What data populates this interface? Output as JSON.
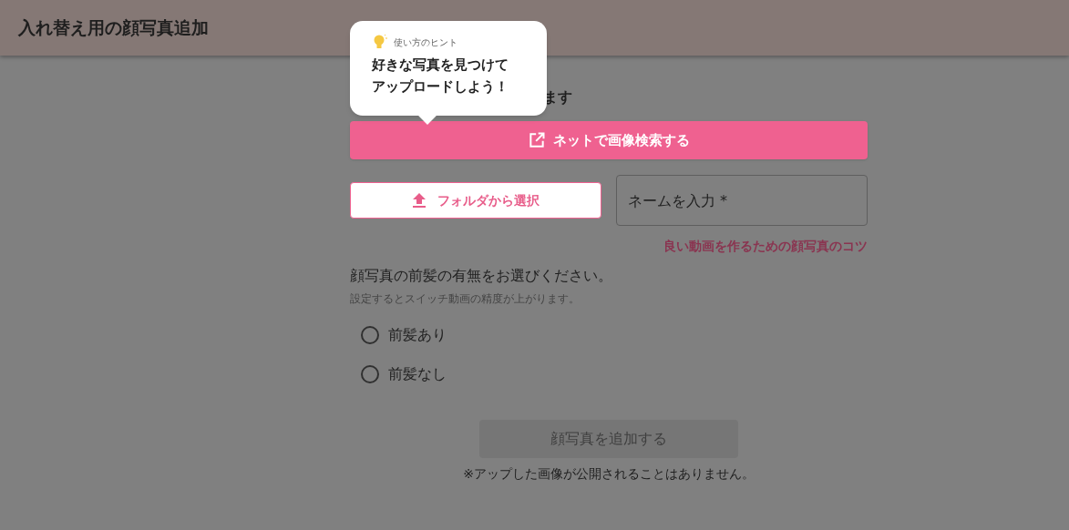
{
  "header": {
    "title": "入れ替え用の顔写真追加"
  },
  "tooltip": {
    "label": "使い方のヒント",
    "message_lines": [
      "好きな写真を見つけて",
      "アップロードしよう！"
    ]
  },
  "intro_text": "ます",
  "search_button": {
    "label": "ネットで画像検索する"
  },
  "folder_button": {
    "label": "フォルダから選択"
  },
  "name_field": {
    "placeholder": "ネームを入力 *"
  },
  "tips_link": "良い動画を作るための顔写真のコツ",
  "bangs": {
    "question": "顔写真の前髪の有無をお選びください。",
    "hint": "設定するとスイッチ動画の精度が上がります。",
    "options": [
      {
        "label": "前髪あり",
        "selected": false
      },
      {
        "label": "前髪なし",
        "selected": false
      }
    ]
  },
  "submit_button": {
    "label": "顔写真を追加する",
    "disabled": true
  },
  "footnote": "※アップした画像が公開されることはありません。"
}
